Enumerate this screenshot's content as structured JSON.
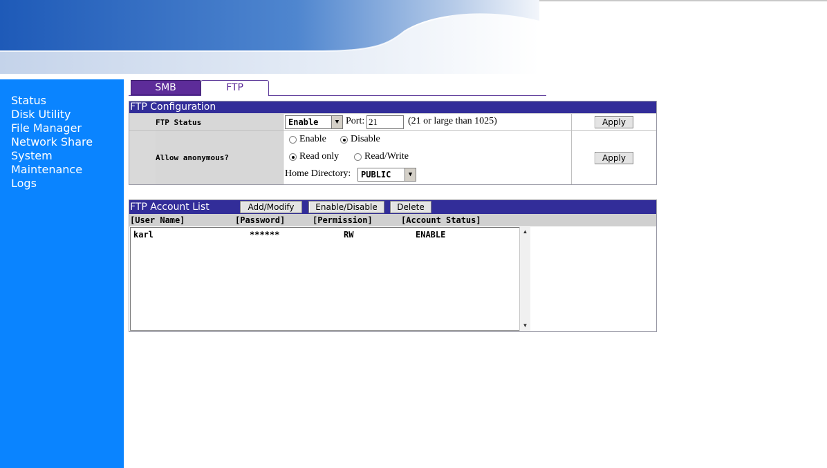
{
  "sidebar": {
    "items": [
      {
        "label": "Status"
      },
      {
        "label": "Disk Utility"
      },
      {
        "label": "File Manager"
      },
      {
        "label": "Network Share"
      },
      {
        "label": "System"
      },
      {
        "label": "Maintenance"
      },
      {
        "label": "Logs"
      }
    ]
  },
  "tabs": [
    {
      "label": "SMB",
      "active": false
    },
    {
      "label": "FTP",
      "active": true
    }
  ],
  "ftp_config": {
    "title": "FTP Configuration",
    "status_label": "FTP Status",
    "status_value": "Enable",
    "port_label": "Port:",
    "port_value": "21",
    "port_hint": "(21 or large than 1025)",
    "apply_label": "Apply",
    "anonymous_label": "Allow anonymous?",
    "anon_enable_label": "Enable",
    "anon_disable_label": "Disable",
    "anon_selected": "Disable",
    "read_only_label": "Read only",
    "read_write_label": "Read/Write",
    "access_selected": "Read only",
    "home_dir_label": "Home Directory:",
    "home_dir_value": "PUBLIC"
  },
  "account_list": {
    "title": "FTP Account List",
    "add_modify_label": "Add/Modify",
    "enable_disable_label": "Enable/Disable",
    "delete_label": "Delete",
    "columns": [
      "[User Name]",
      "[Password]",
      "[Permission]",
      "[Account Status]"
    ],
    "rows": [
      {
        "user": "karl",
        "password": "******",
        "permission": "RW",
        "status": "ENABLE"
      }
    ]
  },
  "icons": {
    "dropdown": "chevron-down-icon",
    "scroll_up": "scroll-up-arrow-icon",
    "scroll_down": "scroll-down-arrow-icon"
  },
  "colors": {
    "sidebar_bg": "#0a84ff",
    "panel_header_bg": "#322d99",
    "tab_active_text": "#5d2c99",
    "tab_inactive_bg": "#5d2c99"
  }
}
